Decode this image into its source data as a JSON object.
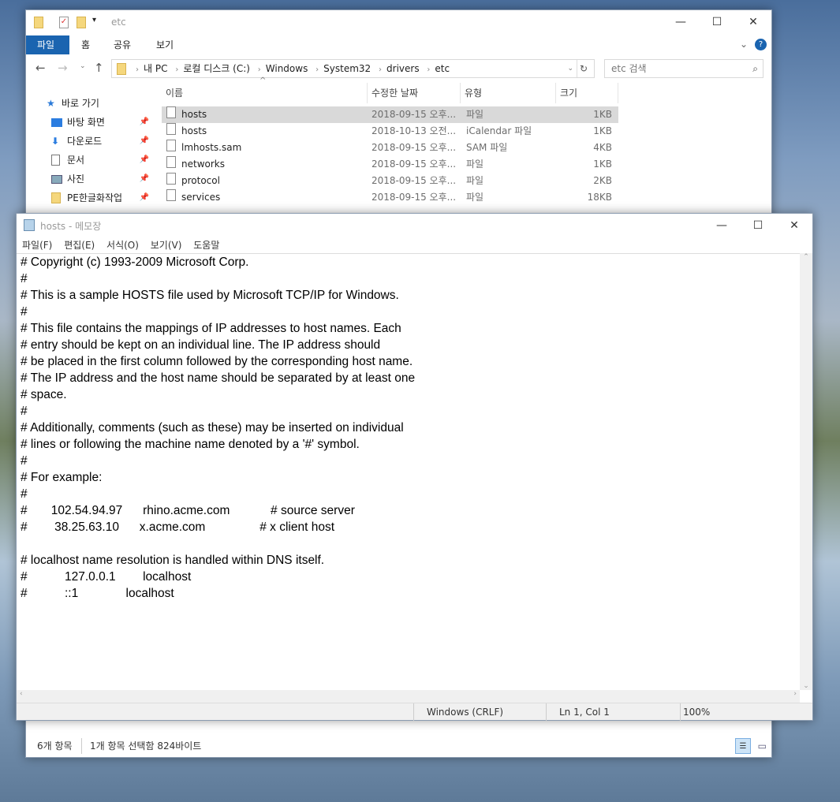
{
  "explorer": {
    "title": "etc",
    "ribbon_tabs": [
      "파일",
      "홈",
      "공유",
      "보기"
    ],
    "breadcrumb": [
      "내 PC",
      "로컬 디스크 (C:)",
      "Windows",
      "System32",
      "drivers",
      "etc"
    ],
    "search_placeholder": "etc 검색",
    "sidebar": [
      {
        "label": "바로 가기",
        "icon": "star-icon"
      },
      {
        "label": "바탕 화면",
        "icon": "desktop-icon"
      },
      {
        "label": "다운로드",
        "icon": "download-icon"
      },
      {
        "label": "문서",
        "icon": "document-icon"
      },
      {
        "label": "사진",
        "icon": "pictures-icon"
      },
      {
        "label": "PE한글화작업",
        "icon": "folder-icon"
      }
    ],
    "columns": [
      "이름",
      "수정한 날짜",
      "유형",
      "크기"
    ],
    "files": [
      {
        "name": "hosts",
        "date": "2018-09-15 오후...",
        "type": "파일",
        "size": "1KB",
        "selected": true
      },
      {
        "name": "hosts",
        "date": "2018-10-13 오전...",
        "type": "iCalendar 파일",
        "size": "1KB"
      },
      {
        "name": "lmhosts.sam",
        "date": "2018-09-15 오후...",
        "type": "SAM 파일",
        "size": "4KB"
      },
      {
        "name": "networks",
        "date": "2018-09-15 오후...",
        "type": "파일",
        "size": "1KB"
      },
      {
        "name": "protocol",
        "date": "2018-09-15 오후...",
        "type": "파일",
        "size": "2KB"
      },
      {
        "name": "services",
        "date": "2018-09-15 오후...",
        "type": "파일",
        "size": "18KB"
      }
    ],
    "status": {
      "count": "6개 항목",
      "selection": "1개 항목 선택함 824바이트"
    }
  },
  "notepad": {
    "title": "hosts - 메모장",
    "menu": [
      "파일(F)",
      "편집(E)",
      "서식(O)",
      "보기(V)",
      "도움말"
    ],
    "lines": [
      "# Copyright (c) 1993-2009 Microsoft Corp.",
      "#",
      "# This is a sample HOSTS file used by Microsoft TCP/IP for Windows.",
      "#",
      "# This file contains the mappings of IP addresses to host names. Each",
      "# entry should be kept on an individual line. The IP address should",
      "# be placed in the first column followed by the corresponding host name.",
      "# The IP address and the host name should be separated by at least one",
      "# space.",
      "#",
      "# Additionally, comments (such as these) may be inserted on individual",
      "# lines or following the machine name denoted by a '#' symbol.",
      "#",
      "# For example:",
      "#",
      "#       102.54.94.97      rhino.acme.com            # source server",
      "#        38.25.63.10      x.acme.com                # x client host",
      "",
      "# localhost name resolution is handled within DNS itself.",
      "#           127.0.0.1        localhost",
      "#           ::1              localhost"
    ],
    "status": {
      "encoding": "Windows (CRLF)",
      "position": "Ln 1, Col 1",
      "zoom": "100%"
    }
  }
}
